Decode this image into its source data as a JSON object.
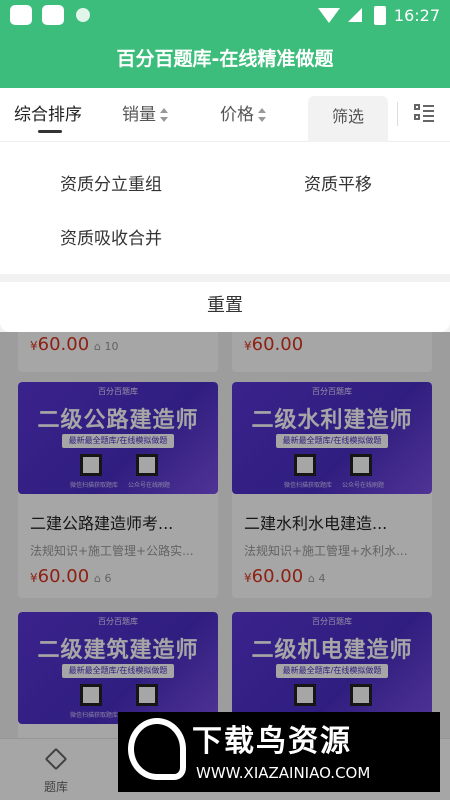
{
  "status": {
    "time": "16:27"
  },
  "app": {
    "title": "百分百题库-在线精准做题"
  },
  "sort_bar": {
    "items": [
      "综合排序",
      "销量",
      "价格"
    ],
    "filter_label": "筛选"
  },
  "filter_panel": {
    "options": [
      "资质分立重组",
      "资质平移",
      "资质吸收合并"
    ],
    "reset_label": "重置"
  },
  "cards": [
    {
      "price_currency": "¥",
      "price": "60.00",
      "sales": "10"
    },
    {
      "price_currency": "¥",
      "price": "60.00",
      "sales": ""
    },
    {
      "banner_top": "百分百题库",
      "banner_title": "二级公路建造师",
      "banner_sub": "最新最全题库/在线模拟做题",
      "qr_left_label": "微信扫描获取题库",
      "qr_right_label": "公众号在线刷题",
      "title": "二建公路建造师考...",
      "desc": "法规知识+施工管理+公路实...",
      "price_currency": "¥",
      "price": "60.00",
      "sales": "6"
    },
    {
      "banner_top": "百分百题库",
      "banner_title": "二级水利建造师",
      "banner_sub": "最新最全题库/在线模拟做题",
      "qr_left_label": "微信扫描获取题库",
      "qr_right_label": "公众号在线刷题",
      "title": "二建水利水电建造...",
      "desc": "法规知识+施工管理+水利水...",
      "price_currency": "¥",
      "price": "60.00",
      "sales": "4"
    },
    {
      "banner_top": "百分百题库",
      "banner_title": "二级建筑建造师",
      "banner_sub": "最新最全题库/在线模拟做题",
      "qr_left_label": "微信扫描获取题库",
      "qr_right_label": ""
    },
    {
      "banner_top": "百分百题库",
      "banner_title": "二级机电建造师",
      "banner_sub": "最新最全题库/在线模拟做题",
      "qr_left_label": "",
      "qr_right_label": ""
    }
  ],
  "tab_bar": {
    "items": [
      "题库"
    ]
  },
  "watermark": {
    "brand": "下载鸟资源",
    "url": "WWW.XIAZAINIAO.COM"
  },
  "colors": {
    "primary": "#3dbd7b",
    "price": "#d9341e",
    "banner": "#4a2fc4"
  }
}
